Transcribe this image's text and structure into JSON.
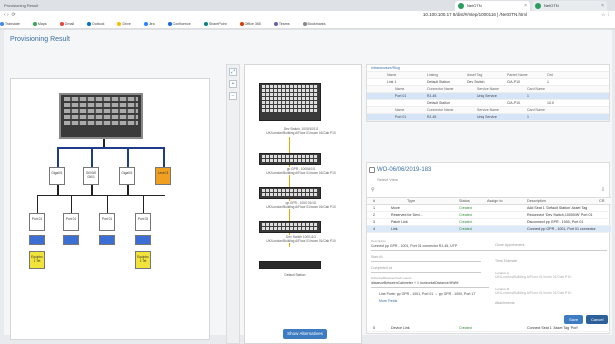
{
  "browser": {
    "tabs": [
      {
        "label": "Provisioning Result"
      },
      {
        "label": "NetOTN"
      },
      {
        "label": "NetOTN"
      }
    ],
    "url": "10.100.100.17 8/dist/#/ntep/1000116 | /NetOTN.html",
    "bookmarks": [
      "Translate",
      "Maps",
      "Gmail",
      "Outlook",
      "Drive",
      "Jira",
      "Confluence",
      "SharePoint",
      "Office 365",
      "Teams",
      "Bookmarks"
    ]
  },
  "modal": {
    "title": "Provisioning Result",
    "show_alternatives": "Show Alternatives",
    "save": "Save",
    "cancel": "Cancel"
  },
  "diagram": {
    "nodes_row1": [
      "Giga0/1",
      "Gi0/0/0 Gi0/1",
      "Giga0/1",
      "Level 3"
    ],
    "nodes_row2": [
      "Port 01",
      "Port 01",
      "Port 01",
      "Port 02"
    ],
    "nodes_row3": [
      "Equiptrc 1 Tet",
      "Equiptrc 1 Tet"
    ]
  },
  "center": {
    "switch1_label": "Dev Switch, 1000/10/1G\nUK/London/Building A/Floor 01/room 01/Cab P10",
    "switch2_label": "pp GPR - 1000A/1G\nUK/London/Building A/Floor 01/room 01/Cab P10",
    "switch3_label": "pp GPR - 1000 01/1G\nUK/London/Building A/Floor 01/room 01/Cab P10",
    "switch4_label": "Dev Switch 10/01/1G\nUK/London/Building A/Floor 01/room 01/Cab P10",
    "default_station": "Default Station"
  },
  "subtable": {
    "section": "Infrastructure/Ring",
    "headers1": [
      "Name",
      "Linking",
      "Asset Tag",
      "Parent Name",
      "Ord"
    ],
    "rows1": [
      [
        "Link 1",
        "Default Station",
        "Dev Switch",
        "CiA-P10",
        "1"
      ]
    ],
    "headers2": [
      "Name",
      "Connector Name",
      "Service Name",
      "Card Name"
    ],
    "rows2": [
      [
        "Port 01",
        "RJ-45",
        "Uniq Service",
        "1"
      ]
    ],
    "rows3": [
      [
        "",
        "Default Station",
        "",
        "CiA-P10",
        "10.0"
      ]
    ],
    "headers4": [
      "Name",
      "Connector Name",
      "Service Name",
      "Card Name"
    ],
    "rows4": [
      [
        "Port 01",
        "RJ-45",
        "Uniq Service",
        "1"
      ]
    ]
  },
  "work_order": {
    "title": "WO-06/06/2019-183",
    "subtitle": "Select View",
    "headers": [
      "#",
      "Type",
      "Status",
      "Assign to",
      "Description",
      "CR"
    ],
    "rows": [
      {
        "n": "1",
        "type": "Move",
        "status": "Created",
        "desc": "Add Seat 1 'Default Station' Asset Tag"
      },
      {
        "n": "2",
        "type": "Reserved for Devi...",
        "status": "Created",
        "desc": "Reconnect 'Dev Switch,10000/W' Port 01"
      },
      {
        "n": "3",
        "type": "Patch Link",
        "status": "Created",
        "desc": "Disconnect pp GPR - 1000, Port 01"
      },
      {
        "n": "4",
        "type": "Link",
        "status": "Created",
        "desc": "Connect pp GPR - 1001, Port 01 connector"
      }
    ],
    "detail": {
      "desc_label": "Description",
      "desc_value": "Connect pp GPR - 1001, Port 01 connector RJ-45, UTP",
      "close_label": "Close Appointment",
      "start_label": "Start At",
      "end_label": "Time Estimate",
      "comp_label": "Completed at",
      "loc_label": "Location A",
      "loc_value": "UK/London/Building A/Floor 01/room 01/Cab P10",
      "dist_label": "Distance/Between/Cab meters",
      "dist_value": "distanceBetweenCabmeter + 1 horizontalDistance/HWM",
      "loc2_label": "Location B",
      "loc2_value": "UK/London/Building A/Floor 01/room 01/Cab P10",
      "attach_label": "Attachments",
      "line_ports": "Line Ports: pp GPR - 1001, Port 01 → pp GPR - 1000, Port 17",
      "more_fields": "More Fields"
    },
    "last_row": {
      "n": "5",
      "type": "Device Link",
      "status": "Created",
      "desc": "Connect Seat 1 'Asset Tag 'Port'"
    }
  }
}
